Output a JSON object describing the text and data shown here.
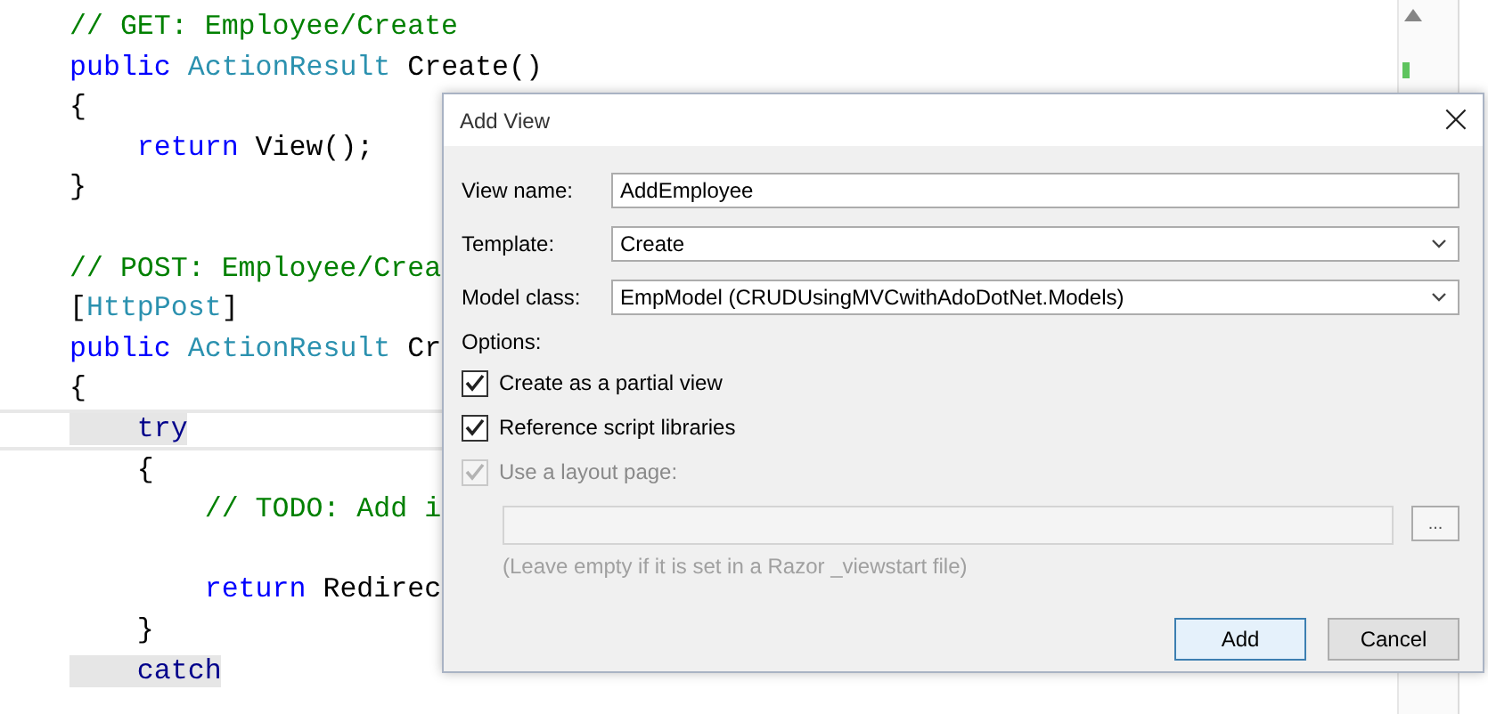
{
  "code_lines": [
    {
      "kind": "code",
      "segments": [
        {
          "kind": "comment",
          "text": "// GET: Employee/Create"
        }
      ]
    },
    {
      "kind": "code",
      "segments": [
        {
          "kind": "keyword",
          "text": "public"
        },
        {
          "kind": "type",
          "text": "ActionResult"
        },
        {
          "kind": "plain",
          "text": "Create()"
        }
      ]
    },
    {
      "kind": "code",
      "segments": [
        {
          "kind": "plain",
          "text": "{"
        }
      ]
    },
    {
      "kind": "code",
      "segments": [
        {
          "kind": "keyword",
          "text": "    return"
        },
        {
          "kind": "plain",
          "text": "View();"
        }
      ]
    },
    {
      "kind": "code",
      "segments": [
        {
          "kind": "plain",
          "text": "}"
        }
      ]
    },
    {
      "kind": "blank"
    },
    {
      "kind": "code",
      "segments": [
        {
          "kind": "comment",
          "text": "// POST: Employee/Crea"
        }
      ]
    },
    {
      "kind": "code",
      "segments": [
        {
          "kind": "attribute",
          "text": "[HttpPost]"
        }
      ]
    },
    {
      "kind": "code",
      "segments": [
        {
          "kind": "keyword",
          "text": "public"
        },
        {
          "kind": "type",
          "text": "ActionResult"
        },
        {
          "kind": "plain",
          "text": "Cr"
        }
      ]
    },
    {
      "kind": "code",
      "segments": [
        {
          "kind": "plain",
          "text": "{"
        }
      ]
    },
    {
      "kind": "code",
      "current": true,
      "segments": [
        {
          "kind": "highlight",
          "text": "    try"
        }
      ]
    },
    {
      "kind": "code",
      "current": false,
      "segments": [
        {
          "kind": "plain",
          "text": "    {"
        }
      ]
    },
    {
      "kind": "code",
      "segments": [
        {
          "kind": "comment",
          "text": "        // TODO: Add i"
        }
      ]
    },
    {
      "kind": "blank"
    },
    {
      "kind": "code",
      "segments": [
        {
          "kind": "keyword",
          "text": "        return"
        },
        {
          "kind": "plain",
          "text": "Redirec"
        }
      ]
    },
    {
      "kind": "code",
      "segments": [
        {
          "kind": "plain",
          "text": "    }"
        }
      ]
    },
    {
      "kind": "code",
      "segments": [
        {
          "kind": "highlight",
          "text": "    catch"
        }
      ]
    }
  ],
  "dialog": {
    "title": "Add View",
    "close": "×",
    "fields": [
      {
        "label": "View name:",
        "kind": "text",
        "value": "AddEmployee"
      },
      {
        "label": "Template:",
        "kind": "dropdown",
        "value": "Create"
      },
      {
        "label": "Model class:",
        "kind": "dropdown",
        "value": "EmpModel (CRUDUsingMVCwithAdoDotNet.Models)"
      }
    ],
    "options_label": "Options:",
    "options": [
      {
        "label": "Create as a partial view",
        "checked": true,
        "disabled": false
      },
      {
        "label": "Reference script libraries",
        "checked": true,
        "disabled": false
      },
      {
        "label": "Use a layout page:",
        "checked": true,
        "disabled": true
      }
    ],
    "layout_page": {
      "disabled": true,
      "browse": "...",
      "hint": "(Leave empty if it is set in a Razor _viewstart file)"
    },
    "buttons": [
      {
        "label": "Add",
        "default": true
      },
      {
        "label": "Cancel",
        "default": false
      }
    ]
  }
}
